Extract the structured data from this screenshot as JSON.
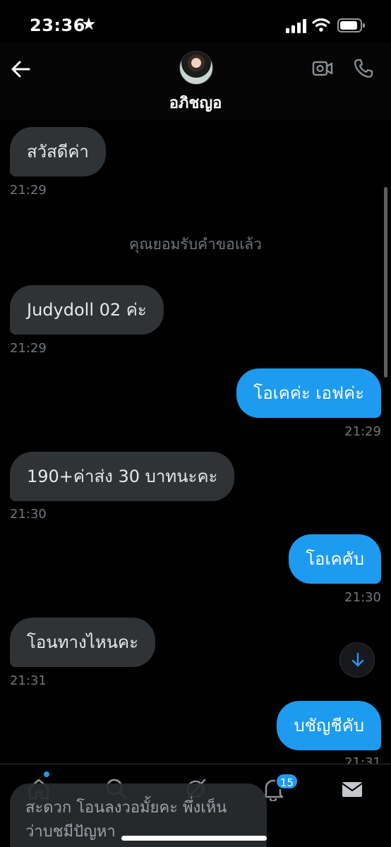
{
  "status_bar": {
    "time": "23:36"
  },
  "header": {
    "contact_name": "อภิชญอ"
  },
  "messages": [
    {
      "dir": "in",
      "text": "สวัสดีค่า",
      "time": "21:29"
    },
    {
      "dir": "system",
      "text": "คุณยอมรับคำขอแล้ว"
    },
    {
      "dir": "in",
      "text": "Judydoll 02 ค่ะ",
      "time": "21:29"
    },
    {
      "dir": "out",
      "text": "โอเคค่ะ เอฟค่ะ",
      "time": "21:29"
    },
    {
      "dir": "in",
      "text": "190+ค่าส่ง 30 บาทนะคะ",
      "time": "21:30"
    },
    {
      "dir": "out",
      "text": "โอเคคับ",
      "time": "21:30"
    },
    {
      "dir": "in",
      "text": "โอนทางไหนคะ",
      "time": "21:31"
    },
    {
      "dir": "out",
      "text": "บชัญชีคับ",
      "time": "21:31"
    }
  ],
  "draft": {
    "line1": "สะดวก โอนลงวอมั้ยคะ พึ่งเห็น",
    "line2": "ว่าบชมีปัญหา"
  },
  "nav": {
    "items": [
      "home-icon",
      "search-icon",
      "grok-icon",
      "bell-icon",
      "mail-icon"
    ],
    "notification_count": "15"
  },
  "colors": {
    "accent": "#1d9bf0",
    "incoming_bubble": "#2f3336",
    "background": "#000000"
  }
}
